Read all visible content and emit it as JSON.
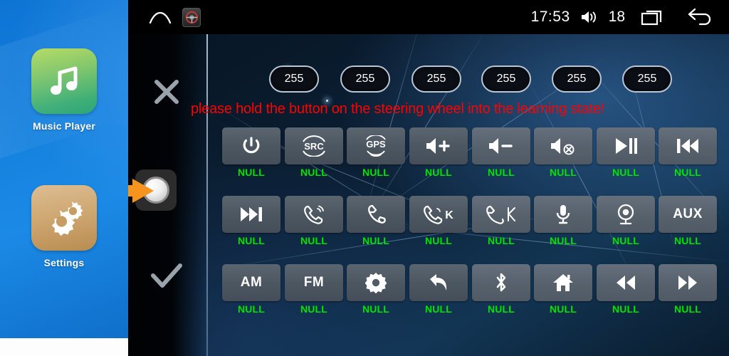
{
  "launcher": {
    "apps": [
      {
        "label": "Music Player",
        "icon": "music-note-icon"
      },
      {
        "label": "Settings",
        "icon": "gears-icon"
      }
    ]
  },
  "statusbar": {
    "home_icon": "home-outline-icon",
    "steering_icon": "steering-wheel-icon",
    "time": "17:53",
    "volume_icon": "speaker-volume-icon",
    "volume_value": "18",
    "recents_icon": "recent-apps-icon",
    "back_icon": "back-arrow-icon"
  },
  "actions": {
    "cancel_icon": "close-x-icon",
    "confirm_icon": "checkmark-icon",
    "knob_icon": "rotary-knob-icon",
    "pointer_icon": "orange-arrow-icon"
  },
  "channels": {
    "values": [
      "255",
      "255",
      "255",
      "255",
      "255",
      "255"
    ]
  },
  "warning": {
    "text": "please hold the button on the steering wheel into the learning state!",
    "color": "#ff0000"
  },
  "grid": {
    "null_label": "NULL",
    "label_color": "#00e400",
    "rows": [
      [
        {
          "icon": "power-icon",
          "label": "NULL"
        },
        {
          "icon": "src-source-icon",
          "label": "NULL"
        },
        {
          "icon": "gps-icon",
          "label": "NULL"
        },
        {
          "icon": "volume-up-icon",
          "label": "NULL"
        },
        {
          "icon": "volume-down-icon",
          "label": "NULL"
        },
        {
          "icon": "mute-icon",
          "label": "NULL"
        },
        {
          "icon": "play-pause-icon",
          "label": "NULL"
        },
        {
          "icon": "previous-track-icon",
          "label": "NULL"
        }
      ],
      [
        {
          "icon": "next-track-icon",
          "label": "NULL"
        },
        {
          "icon": "phone-answer-icon",
          "label": "NULL"
        },
        {
          "icon": "phone-hangup-icon",
          "label": "NULL"
        },
        {
          "icon": "phone-answer-key-icon",
          "label": "NULL"
        },
        {
          "icon": "phone-hangup-key-icon",
          "label": "NULL"
        },
        {
          "icon": "microphone-icon",
          "label": "NULL"
        },
        {
          "icon": "camera-icon",
          "label": "NULL"
        },
        {
          "icon": "aux-icon",
          "text": "AUX",
          "label": "NULL"
        }
      ],
      [
        {
          "icon": "am-band-icon",
          "text": "AM",
          "label": "NULL"
        },
        {
          "icon": "fm-band-icon",
          "text": "FM",
          "label": "NULL"
        },
        {
          "icon": "settings-gear-icon",
          "label": "NULL"
        },
        {
          "icon": "back-return-icon",
          "label": "NULL"
        },
        {
          "icon": "bluetooth-icon",
          "label": "NULL"
        },
        {
          "icon": "home-icon",
          "label": "NULL"
        },
        {
          "icon": "rewind-icon",
          "label": "NULL"
        },
        {
          "icon": "fast-forward-icon",
          "label": "NULL"
        }
      ]
    ]
  }
}
